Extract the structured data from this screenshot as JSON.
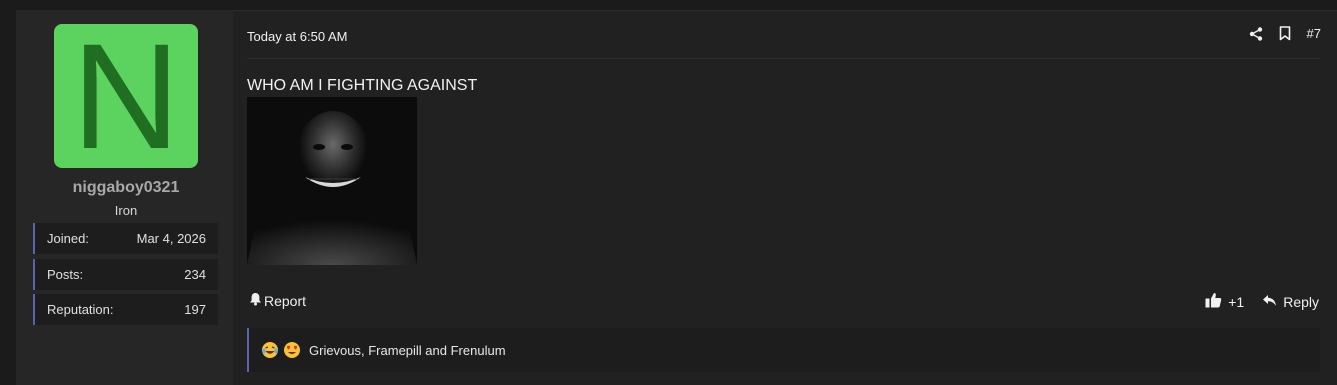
{
  "user": {
    "avatar_letter": "N",
    "avatar_color": "#5cd35e",
    "username": "niggaboy0321",
    "title": "Iron",
    "stats": [
      {
        "label": "Joined:",
        "value": "Mar 4, 2026"
      },
      {
        "label": "Posts:",
        "value": "234"
      },
      {
        "label": "Reputation:",
        "value": "197"
      }
    ]
  },
  "post": {
    "timestamp": "Today at 6:50 AM",
    "post_number": "#7",
    "message": "WHO AM I FIGHTING AGAINST",
    "report_label": "Report",
    "like_count": "+1",
    "reply_label": "Reply",
    "reactions_text": "Grievous, Framepill and Frenulum",
    "icons": [
      "share-icon",
      "bookmark-icon",
      "bell-icon",
      "thumbs-up-icon",
      "reply-arrow-icon",
      "laughing-crying-emoji",
      "heart-eyes-emoji"
    ]
  },
  "colors": {
    "accent": "#5a64b0",
    "background": "#212121",
    "sidebar": "#262626"
  }
}
